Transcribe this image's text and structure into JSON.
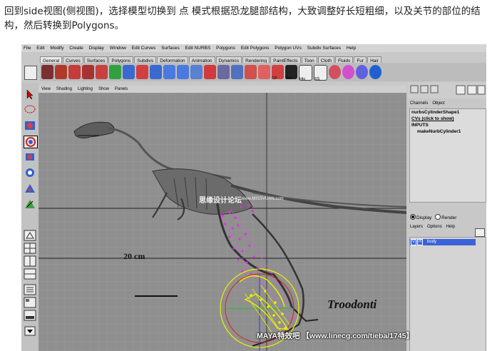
{
  "caption": "回到side视图(侧视图)，选择模型切换到 点 模式根据恐龙腿部结构，大致调整好长短粗细，以及关节的部位的结构，然后转换到Polygons。",
  "menubar": [
    "File",
    "Edit",
    "Modify",
    "Create",
    "Display",
    "Window",
    "Edit Curves",
    "Surfaces",
    "Edit NURBS",
    "Polygons",
    "Edit Polygons",
    "Polygon UVs",
    "Subdiv Surfaces",
    "Help"
  ],
  "shelf_tabs": [
    {
      "label": "General",
      "active": true
    },
    {
      "label": "Curves"
    },
    {
      "label": "Surfaces"
    },
    {
      "label": "Polygons"
    },
    {
      "label": "Subdivs"
    },
    {
      "label": "Deformation"
    },
    {
      "label": "Animation"
    },
    {
      "label": "Dynamics"
    },
    {
      "label": "Rendering"
    },
    {
      "label": "PaintEffects"
    },
    {
      "label": "Toon"
    },
    {
      "label": "Cloth"
    },
    {
      "label": "Fluids"
    },
    {
      "label": "Fur"
    },
    {
      "label": "Hair"
    }
  ],
  "shelf_labels": {
    "cp": "CP",
    "out": "Out",
    "his": "His",
    "ss": "SS"
  },
  "panel_menu": [
    "View",
    "Shading",
    "Lighting",
    "Show",
    "Panels"
  ],
  "channel_box": {
    "tabs": [
      "Channels",
      "Object"
    ],
    "shape_name": "nurbsCylinderShape1",
    "cvs_label": "CVs (click to show)",
    "inputs_label": "INPUTS",
    "input_item": "makeNurbCylinder1"
  },
  "layer_editor": {
    "display_label": "Display",
    "render_label": "Render",
    "menu": [
      "Layers",
      "Options",
      "Help"
    ],
    "layer_v": "V",
    "layer_r": "R",
    "layer_name": "body"
  },
  "viewport": {
    "watermark_cn": "思缘设计论坛",
    "watermark_url": "www.MISSVUAN.com",
    "scale_label": "20 cm",
    "species_label": "Troodonti"
  },
  "credit": "MAYA特效吧 【www.linecg.com/tieba/1745】",
  "colors": {
    "viewport_bg": "#8f8f8f",
    "grid": "#a2a2a2",
    "cv_points": "#e030e0",
    "selection_yellow": "#f0f000",
    "manip_red": "#d02020",
    "manip_green": "#20c020",
    "manip_blue": "#2040e0",
    "layer_highlight": "#3b63d9"
  }
}
